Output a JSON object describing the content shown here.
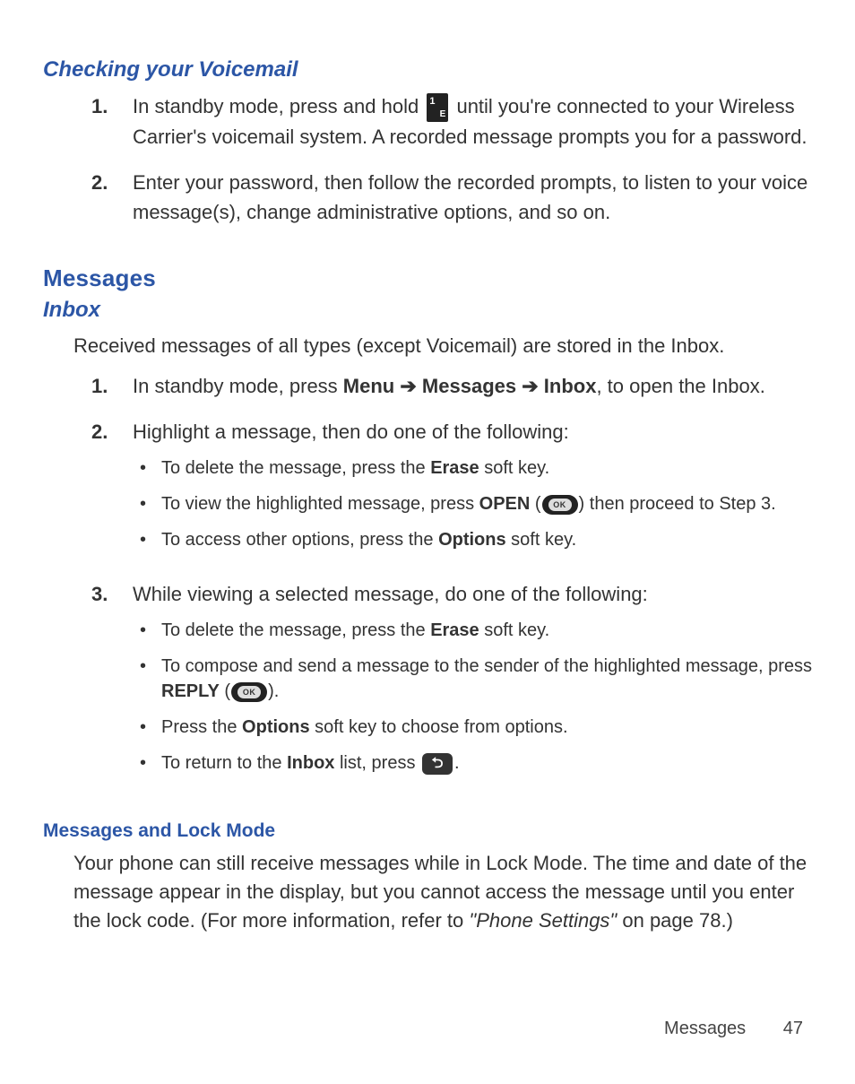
{
  "voicemail": {
    "heading": "Checking your Voicemail",
    "steps": [
      {
        "before_icon": "In standby mode, press and hold ",
        "after_icon": " until you're connected to your Wireless Carrier's voicemail system. A recorded message prompts you for a password."
      },
      {
        "text": "Enter your password, then follow the recorded prompts, to listen to your voice message(s), change administrative options, and so on."
      }
    ]
  },
  "messages": {
    "heading": "Messages",
    "inbox": {
      "heading": "Inbox",
      "intro": "Received messages of all types (except Voicemail) are stored in the Inbox.",
      "steps": [
        {
          "before": "In standby mode, press ",
          "menu": "Menu",
          "arrow1": " ➔ ",
          "messages": "Messages",
          "arrow2": " ➔ ",
          "inbox": "Inbox",
          "after": ", to open the Inbox."
        },
        {
          "text": "Highlight a message, then do one of the following:",
          "bullets": [
            {
              "before": "To delete the message, press the ",
              "bold": "Erase",
              "after": " soft key."
            },
            {
              "before": "To view the highlighted message, press ",
              "bold": "OPEN",
              "paren_open": " (",
              "paren_close": ") ",
              "after": " then proceed to Step 3."
            },
            {
              "before": "To access other options, press the ",
              "bold": "Options",
              "after": " soft key."
            }
          ]
        },
        {
          "text": "While viewing a selected message, do one of the following:",
          "bullets": [
            {
              "before": "To delete the message, press the ",
              "bold": "Erase",
              "after": " soft key."
            },
            {
              "before": "To compose and send a message to the sender of the highlighted message, press ",
              "bold": "REPLY",
              "paren_open": " (",
              "paren_close": ").",
              "after": ""
            },
            {
              "before": "Press the ",
              "bold": "Options",
              "after": " soft key to choose from options."
            },
            {
              "before": "To return to the ",
              "bold": "Inbox",
              "mid": " list, press ",
              "after": "."
            }
          ]
        }
      ]
    },
    "lock_mode": {
      "heading": "Messages and Lock Mode",
      "text_before": "Your phone can still receive messages while in Lock Mode. The time and date of the message appear in the display, but you cannot access the message until you enter the lock code. (For more information, refer to ",
      "ref": "\"Phone Settings\"",
      "text_after": "  on page 78.)"
    }
  },
  "footer": {
    "label": "Messages",
    "page": "47"
  }
}
